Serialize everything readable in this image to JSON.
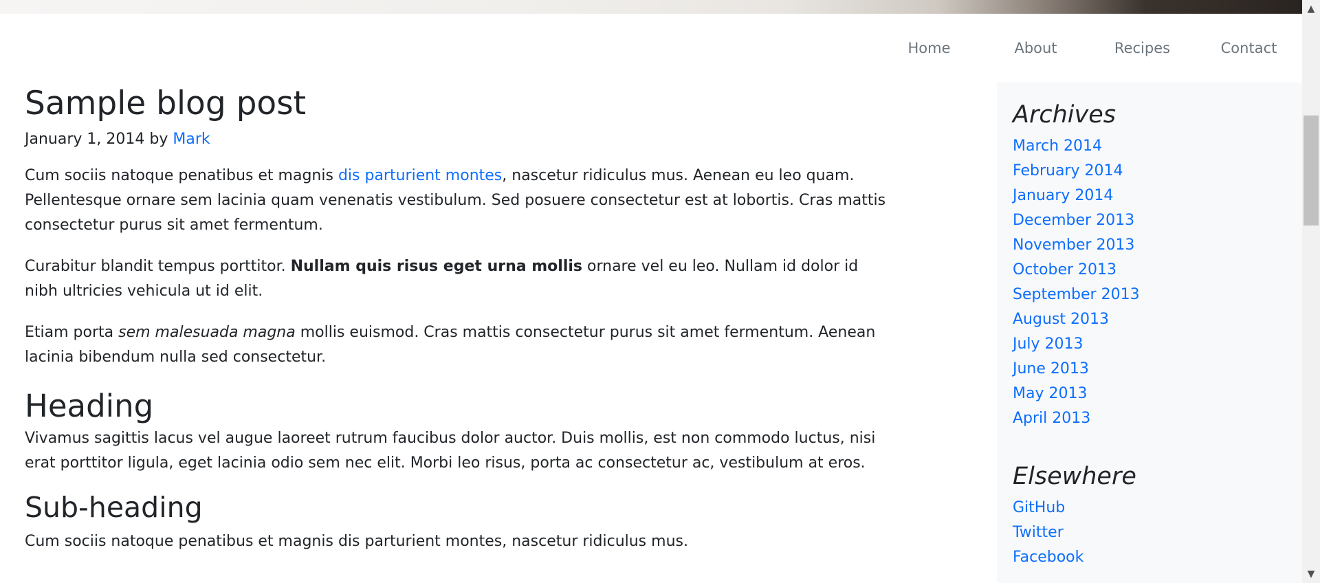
{
  "nav": {
    "items": [
      {
        "label": "Home"
      },
      {
        "label": "About"
      },
      {
        "label": "Recipes"
      },
      {
        "label": "Contact"
      }
    ]
  },
  "post": {
    "title": "Sample blog post",
    "date": "January 1, 2014",
    "by": "by",
    "author": "Mark",
    "p1": {
      "before": "Cum sociis natoque penatibus et magnis ",
      "link": "dis parturient montes",
      "after": ", nascetur ridiculus mus. Aenean eu leo quam. Pellentesque ornare sem lacinia quam venenatis vestibulum. Sed posuere consectetur est at lobortis. Cras mattis consectetur purus sit amet fermentum."
    },
    "p2": {
      "before": "Curabitur blandit tempus porttitor. ",
      "bold": "Nullam quis risus eget urna mollis",
      "after": " ornare vel eu leo. Nullam id dolor id nibh ultricies vehicula ut id elit."
    },
    "p3": {
      "before": "Etiam porta ",
      "italic": "sem malesuada magna",
      "after": " mollis euismod. Cras mattis consectetur purus sit amet fermentum. Aenean lacinia bibendum nulla sed consectetur."
    },
    "heading": "Heading",
    "p4": "Vivamus sagittis lacus vel augue laoreet rutrum faucibus dolor auctor. Duis mollis, est non commodo luctus, nisi erat porttitor ligula, eget lacinia odio sem nec elit. Morbi leo risus, porta ac consectetur ac, vestibulum at eros.",
    "subheading": "Sub-heading",
    "p5": "Cum sociis natoque penatibus et magnis dis parturient montes, nascetur ridiculus mus."
  },
  "sidebar": {
    "archives_title": "Archives",
    "archives": [
      "March 2014",
      "February 2014",
      "January 2014",
      "December 2013",
      "November 2013",
      "October 2013",
      "September 2013",
      "August 2013",
      "July 2013",
      "June 2013",
      "May 2013",
      "April 2013"
    ],
    "elsewhere_title": "Elsewhere",
    "elsewhere": [
      "GitHub",
      "Twitter",
      "Facebook"
    ]
  },
  "colors": {
    "link": "#0d6efd",
    "nav_text": "#6c757d",
    "sidebar_bg": "#f8f9fa"
  }
}
